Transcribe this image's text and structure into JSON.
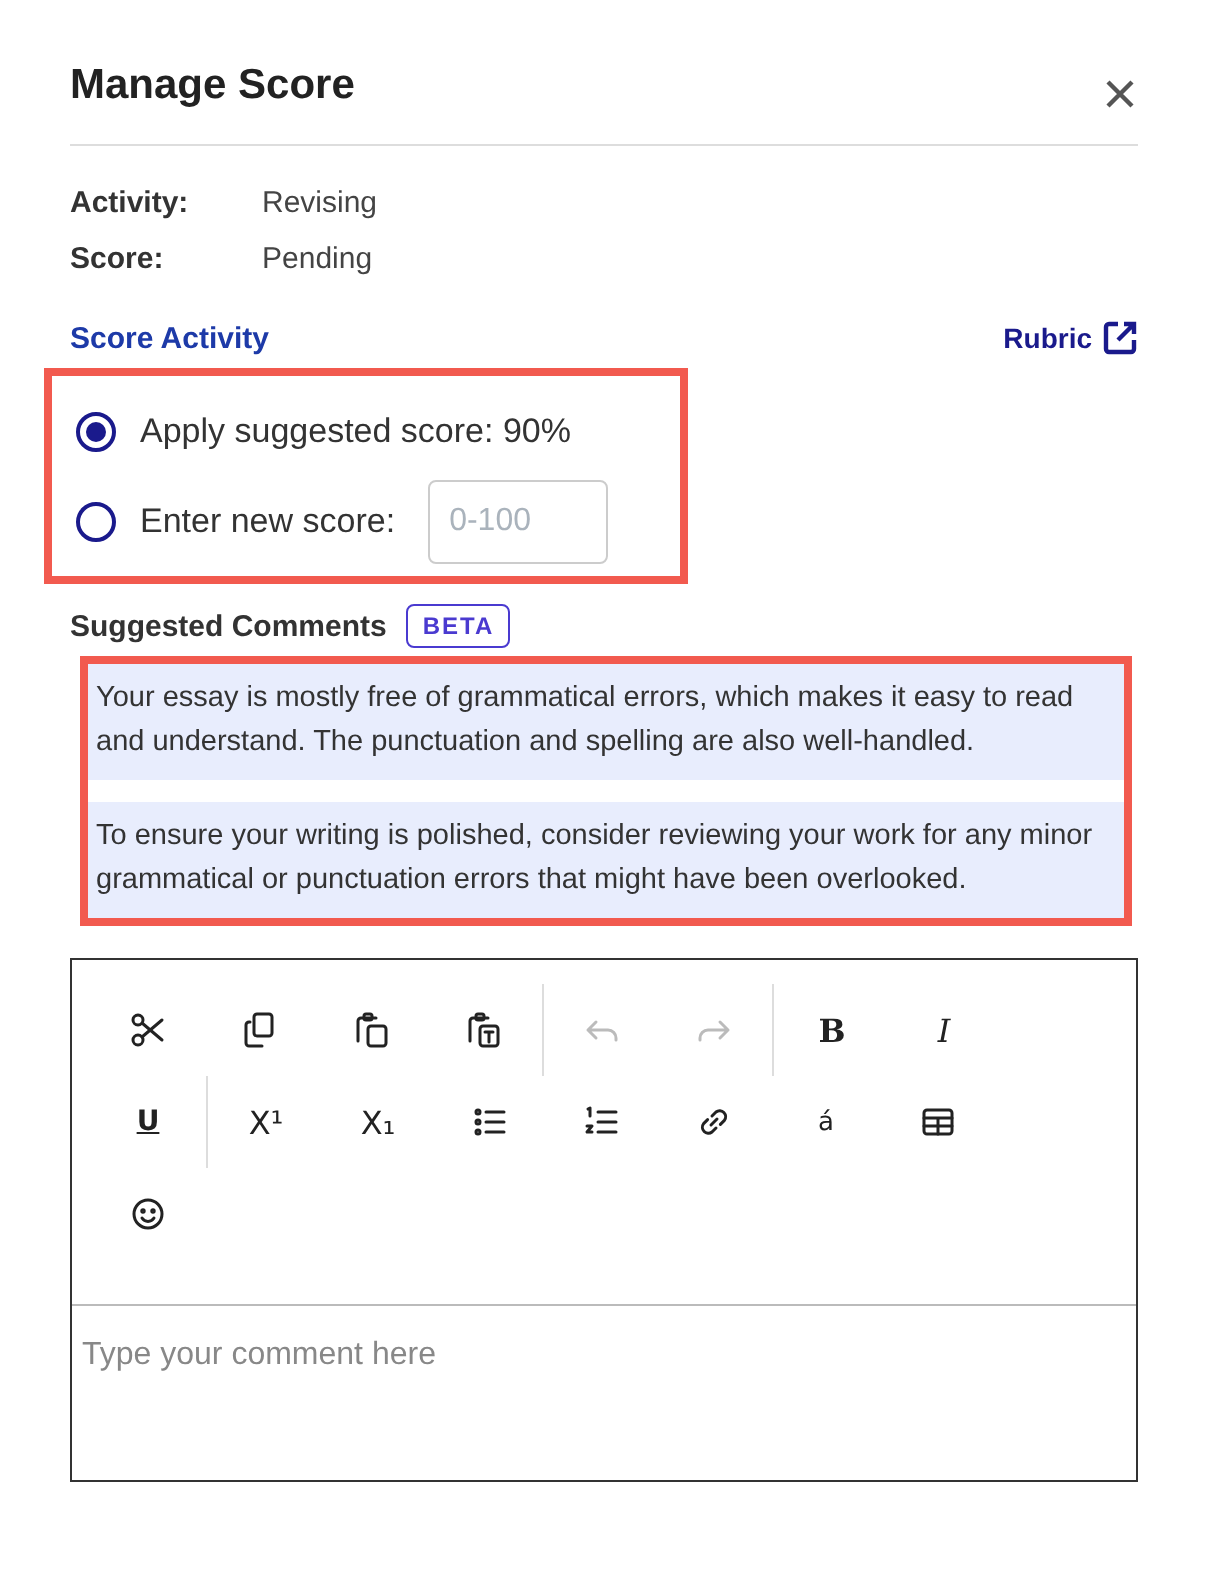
{
  "title": "Manage Score",
  "details": [
    {
      "label": "Activity:",
      "value": "Revising"
    },
    {
      "label": "Score:",
      "value": "Pending"
    }
  ],
  "score_activity": {
    "heading": "Score Activity",
    "rubric_link": "Rubric"
  },
  "score_options": [
    {
      "kind": "suggested",
      "label": "Apply suggested score: 90%",
      "selected": true
    },
    {
      "kind": "custom",
      "label": "Enter new score:",
      "placeholder": "0-100",
      "selected": false
    }
  ],
  "suggested_comments": {
    "heading": "Suggested Comments",
    "badge": "BETA",
    "comments": [
      "Your essay is mostly free of grammatical errors, which makes it easy to read and understand. The punctuation and spelling are also well-handled.",
      "To ensure your writing is polished, consider reviewing your work for any minor grammatical or punctuation errors that might have been overlooked."
    ]
  },
  "toolbar": [
    {
      "kind": "cut",
      "disabled": false
    },
    {
      "kind": "copy",
      "disabled": false
    },
    {
      "kind": "paste",
      "disabled": false
    },
    {
      "kind": "paste-text",
      "disabled": false
    },
    {
      "kind": "separator"
    },
    {
      "kind": "undo",
      "disabled": true
    },
    {
      "kind": "redo",
      "disabled": true
    },
    {
      "kind": "separator"
    },
    {
      "kind": "bold",
      "glyph": "B",
      "disabled": false
    },
    {
      "kind": "italic",
      "glyph": "I",
      "disabled": false
    },
    {
      "kind": "underline",
      "glyph": "U",
      "disabled": false
    },
    {
      "kind": "separator"
    },
    {
      "kind": "superscript",
      "glyph": "X¹",
      "disabled": false
    },
    {
      "kind": "subscript",
      "glyph": "X₁",
      "disabled": false
    },
    {
      "kind": "bullet-list",
      "disabled": false
    },
    {
      "kind": "numbered-list",
      "disabled": false
    },
    {
      "kind": "link",
      "disabled": false
    },
    {
      "kind": "special-char",
      "glyph": "á",
      "disabled": false
    },
    {
      "kind": "table",
      "disabled": false
    },
    {
      "kind": "emoji",
      "disabled": false
    }
  ],
  "editor": {
    "placeholder": "Type your comment here"
  }
}
